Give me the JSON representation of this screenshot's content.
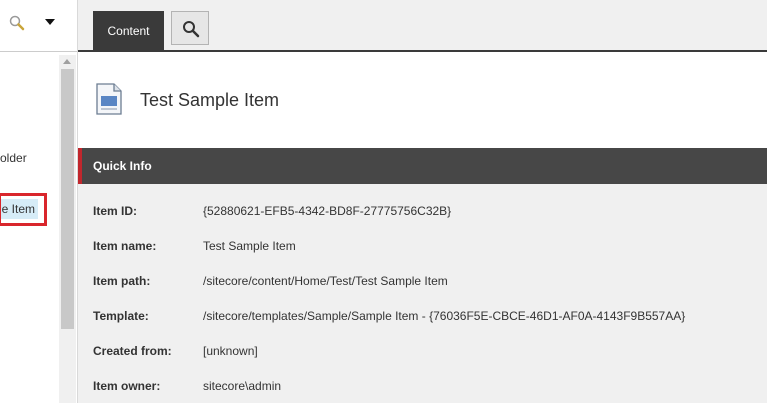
{
  "tree": {
    "folder_label_fragment": "older",
    "selected_label_fragment": "e Item"
  },
  "tabs": {
    "content_label": "Content",
    "search_icon": "search-icon"
  },
  "item": {
    "title": "Test Sample Item",
    "icon": "document-icon"
  },
  "quick_info": {
    "title": "Quick Info",
    "rows": [
      {
        "label": "Item ID:",
        "value": "{52880621-EFB5-4342-BD8F-27775756C32B}"
      },
      {
        "label": "Item name:",
        "value": "Test Sample Item"
      },
      {
        "label": "Item path:",
        "value": "/sitecore/content/Home/Test/Test Sample Item"
      },
      {
        "label": "Template:",
        "value": "/sitecore/templates/Sample/Sample Item - {76036F5E-CBCE-46D1-AF0A-4143F9B557AA}"
      },
      {
        "label": "Created from:",
        "value": "[unknown]"
      },
      {
        "label": "Item owner:",
        "value": "sitecore\\admin"
      }
    ]
  },
  "colors": {
    "accent_red": "#c1272d",
    "selection_blue": "#d6ecf7",
    "dark_bar": "#474747"
  }
}
